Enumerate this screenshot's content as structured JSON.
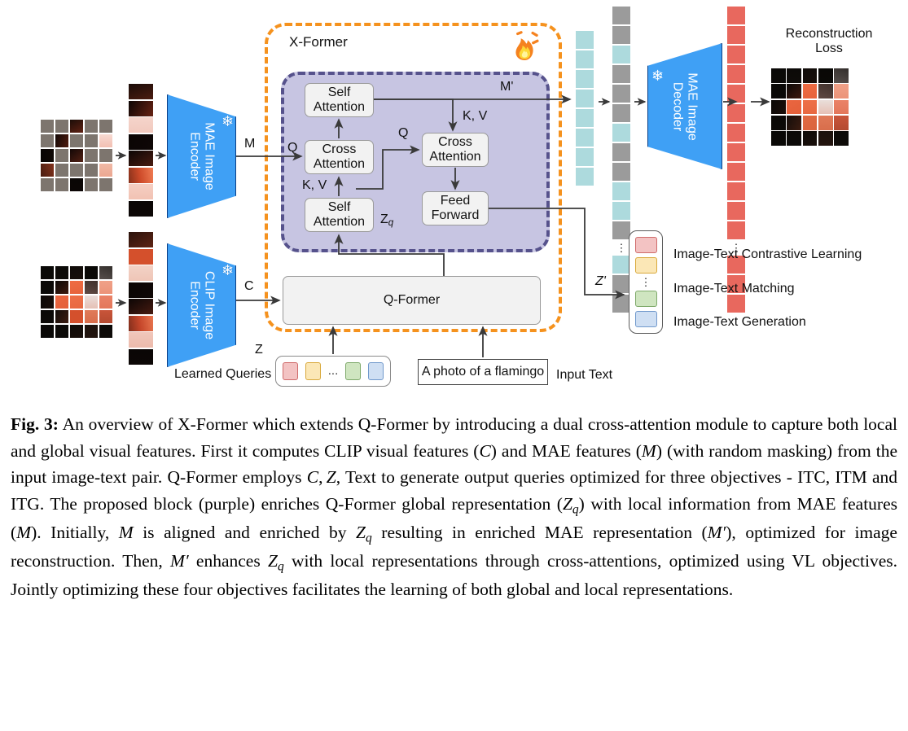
{
  "figure": {
    "xformer_label": "X-Former",
    "fire_icon": "fire-icon",
    "snowflake_icon": "snowflake-icon",
    "blocks": {
      "self_attention_top": "Self\nAttention",
      "self_attention_top_l1": "Self",
      "self_attention_top_l2": "Attention",
      "cross_attention_left_l1": "Cross",
      "cross_attention_left_l2": "Attention",
      "self_attention_bottom_l1": "Self",
      "self_attention_bottom_l2": "Attention",
      "cross_attention_right_l1": "Cross",
      "cross_attention_right_l2": "Attention",
      "feed_forward_l1": "Feed",
      "feed_forward_l2": "Forward",
      "qformer": "Q-Former",
      "mae_image_encoder_l1": "MAE Image",
      "mae_image_encoder_l2": "Encoder",
      "clip_image_encoder_l1": "CLIP Image",
      "clip_image_encoder_l2": "Encoder",
      "mae_image_decoder_l1": "MAE Image",
      "mae_image_decoder_l2": "Decoder"
    },
    "edge_labels": {
      "M": "M",
      "C": "C",
      "Q_left": "Q",
      "Q_mid": "Q",
      "KV_left": "K, V",
      "KV_top": "K, V",
      "M_prime": "M'",
      "Zq": "Zq",
      "Zq_base": "Z",
      "Zq_sub": "q",
      "Z_prime": "Z'",
      "Z": "Z"
    },
    "texts": {
      "learned_queries": "Learned Queries",
      "input_text_value": "A photo of a flamingo",
      "input_text_label": "Input Text",
      "reconstruction_loss_l1": "Reconstruction",
      "reconstruction_loss_l2": "Loss"
    },
    "objectives": [
      {
        "name": "itc",
        "color": "#f3c3c3",
        "label": "Image-Text Contrastive Learning"
      },
      {
        "name": "itm",
        "color": "#fbe7b6",
        "label": "Image-Text Matching"
      },
      {
        "name": "itg",
        "color": "#cfe5c0",
        "label": "Image-Text Generation"
      }
    ],
    "objective_chip_colors": [
      "#f3c3c3",
      "#fbe7b6",
      "#cfe5c0",
      "#cfdff3"
    ],
    "query_chip_colors": [
      "#f3c3c3",
      "#fbe7b6",
      "#cfe5c0",
      "#cfdff3"
    ],
    "queries_ellipsis": "...",
    "token_columns": {
      "teal_count": 8,
      "mixed_pattern": [
        "gray",
        "gray",
        "teal",
        "gray",
        "gray",
        "gray",
        "teal",
        "gray",
        "gray",
        "teal",
        "teal",
        "gray",
        "dots",
        "teal",
        "gray",
        "gray"
      ],
      "red_count_top": 12,
      "red_count_bottom": 3
    },
    "colors": {
      "accent_orange": "#f5921e",
      "purple_fill": "#c7c5e2",
      "purple_border": "#56528c",
      "encoder_blue": "#3fa0f5",
      "token_teal": "#addadd",
      "token_gray": "#9b9b9b",
      "token_red": "#e8685e",
      "box_fill": "#f2f2f2"
    }
  },
  "caption": {
    "prefix": "Fig. 3:",
    "text": "An overview of X-Former which extends Q-Former by introducing a dual cross-attention module to capture both local and global visual features. First it computes CLIP visual features (C) and MAE features (M) (with random masking) from the input image-text pair. Q-Former employs C, Z, Text to generate output queries optimized for three objectives - ITC, ITM and ITG. The proposed block (purple) enriches Q-Former global representation (Zq) with local information from MAE features (M). Initially, M is aligned and enriched by Zq resulting in enriched MAE representation (M'), optimized for image reconstruction. Then, M' enhances Zq with local representations through cross-attentions, optimized using VL objectives. Jointly optimizing these four objectives facilitates the learning of both global and local representations."
  }
}
